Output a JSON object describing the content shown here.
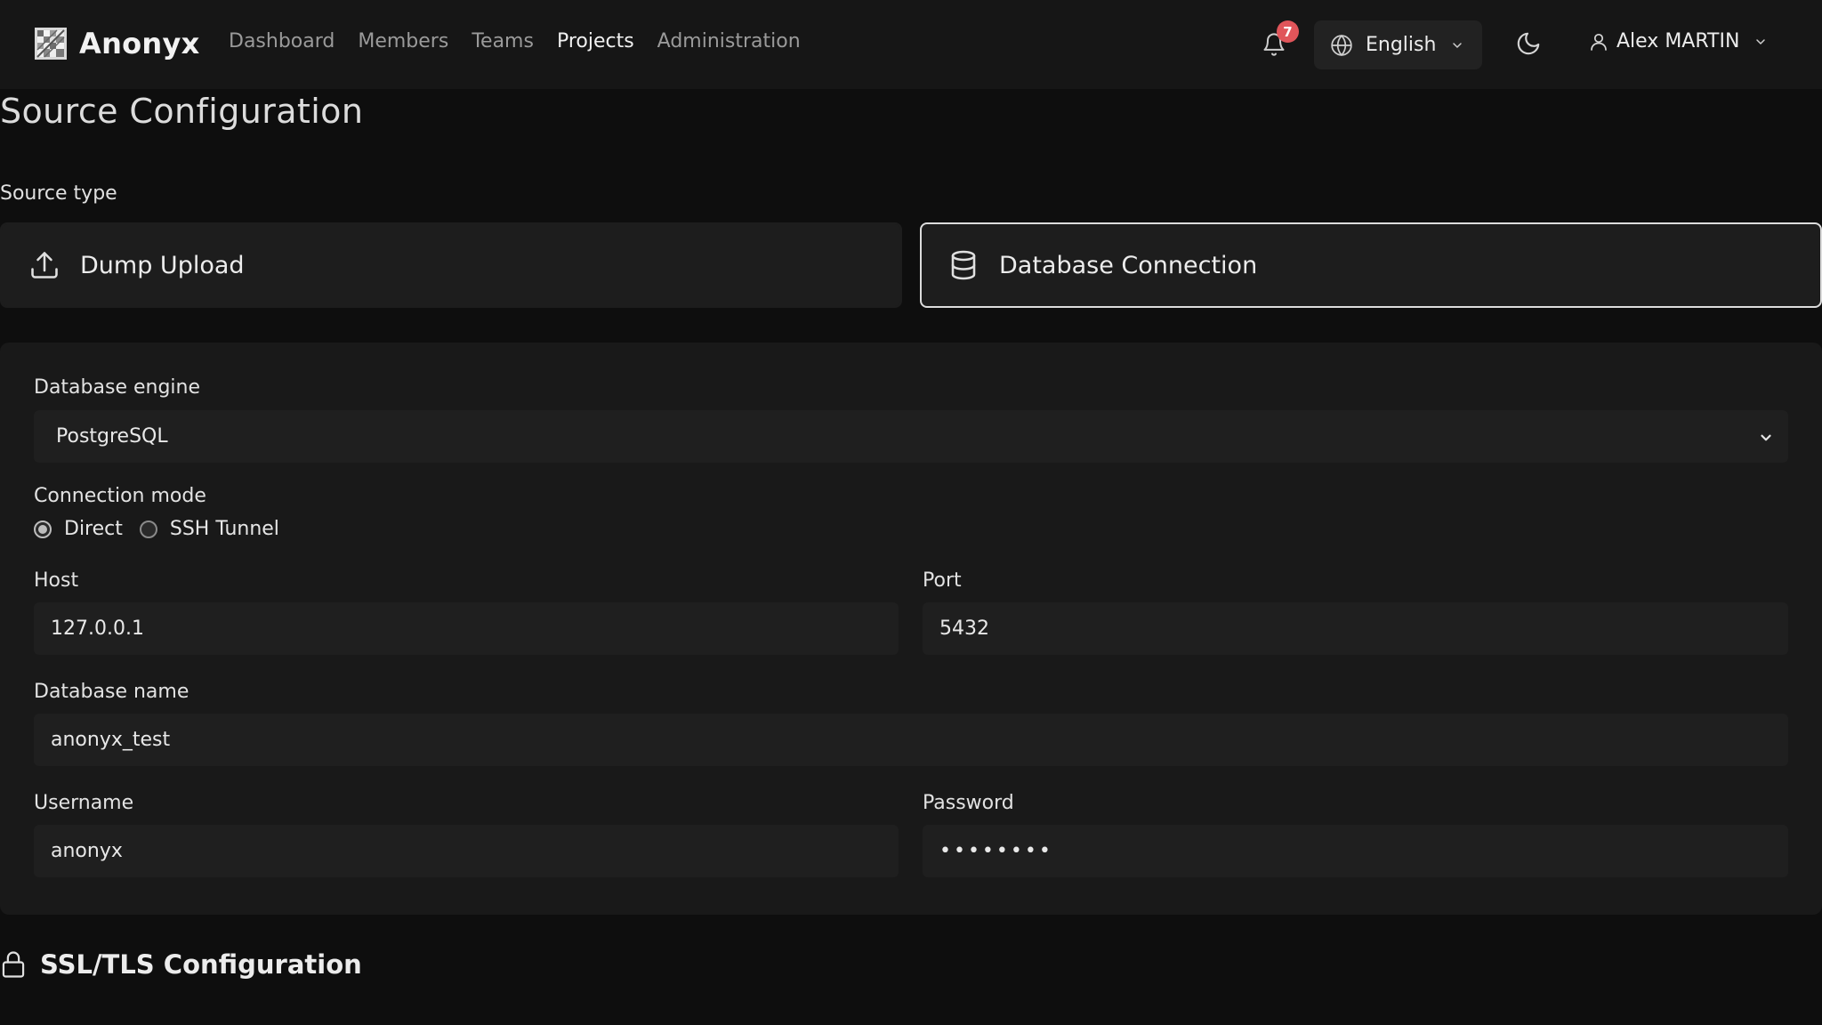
{
  "brand": {
    "name": "Anonyx",
    "logo_icon": "anonyx-logo-icon"
  },
  "nav": {
    "links": [
      {
        "label": "Dashboard",
        "active": false
      },
      {
        "label": "Members",
        "active": false
      },
      {
        "label": "Teams",
        "active": false
      },
      {
        "label": "Projects",
        "active": true
      },
      {
        "label": "Administration",
        "active": false
      }
    ],
    "notifications": {
      "icon": "bell-icon",
      "count": "7",
      "badge_color": "#e0555a"
    },
    "language": {
      "icon": "globe-icon",
      "selected": "English"
    },
    "theme_toggle": {
      "icon": "moon-icon"
    },
    "user": {
      "icon": "user-icon",
      "name": "Alex MARTIN"
    }
  },
  "page": {
    "title": "Source Configuration",
    "source_type": {
      "label": "Source type",
      "options": [
        {
          "label": "Dump Upload",
          "icon": "upload-icon",
          "selected": false
        },
        {
          "label": "Database Connection",
          "icon": "database-icon",
          "selected": true
        }
      ]
    },
    "form": {
      "engine": {
        "label": "Database engine",
        "value": "PostgreSQL"
      },
      "connection_mode": {
        "label": "Connection mode",
        "options": [
          {
            "label": "Direct",
            "checked": true
          },
          {
            "label": "SSH Tunnel",
            "checked": false
          }
        ]
      },
      "host": {
        "label": "Host",
        "value": "127.0.0.1"
      },
      "port": {
        "label": "Port",
        "value": "5432"
      },
      "database_name": {
        "label": "Database name",
        "value": "anonyx_test"
      },
      "username": {
        "label": "Username",
        "value": "anonyx"
      },
      "password": {
        "label": "Password",
        "value": "••••••••"
      }
    },
    "ssl": {
      "icon": "lock-icon",
      "title": "SSL/TLS Configuration"
    }
  },
  "colors": {
    "background": "#0e0e0e",
    "navbar": "#161616",
    "panel": "#191919",
    "input": "#1f1f1f",
    "selected_border": "#dcdcdc",
    "badge": "#e0555a"
  }
}
